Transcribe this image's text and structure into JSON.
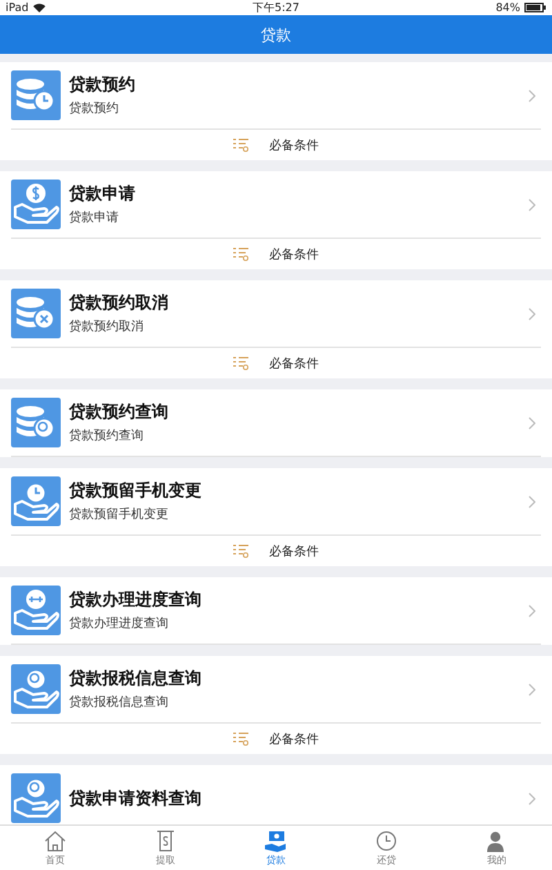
{
  "status_bar": {
    "device": "iPad",
    "time": "下午5:27",
    "battery": "84%"
  },
  "nav_bar": {
    "title": "贷款"
  },
  "items": [
    {
      "title": "贷款预约",
      "subtitle": "贷款预约",
      "footer": "必备条件"
    },
    {
      "title": "贷款申请",
      "subtitle": "贷款申请",
      "footer": "必备条件"
    },
    {
      "title": "贷款预约取消",
      "subtitle": "贷款预约取消",
      "footer": "必备条件"
    },
    {
      "title": "贷款预约查询",
      "subtitle": "贷款预约查询"
    },
    {
      "title": "贷款预留手机变更",
      "subtitle": "贷款预留手机变更",
      "footer": "必备条件"
    },
    {
      "title": "贷款办理进度查询",
      "subtitle": "贷款办理进度查询"
    },
    {
      "title": "贷款报税信息查询",
      "subtitle": "贷款报税信息查询",
      "footer": "必备条件"
    },
    {
      "title": "贷款申请资料查询"
    }
  ],
  "tabs": [
    {
      "label": "首页",
      "selected": false
    },
    {
      "label": "提取",
      "selected": false
    },
    {
      "label": "贷款",
      "selected": true
    },
    {
      "label": "还贷",
      "selected": false
    },
    {
      "label": "我的",
      "selected": false
    }
  ]
}
